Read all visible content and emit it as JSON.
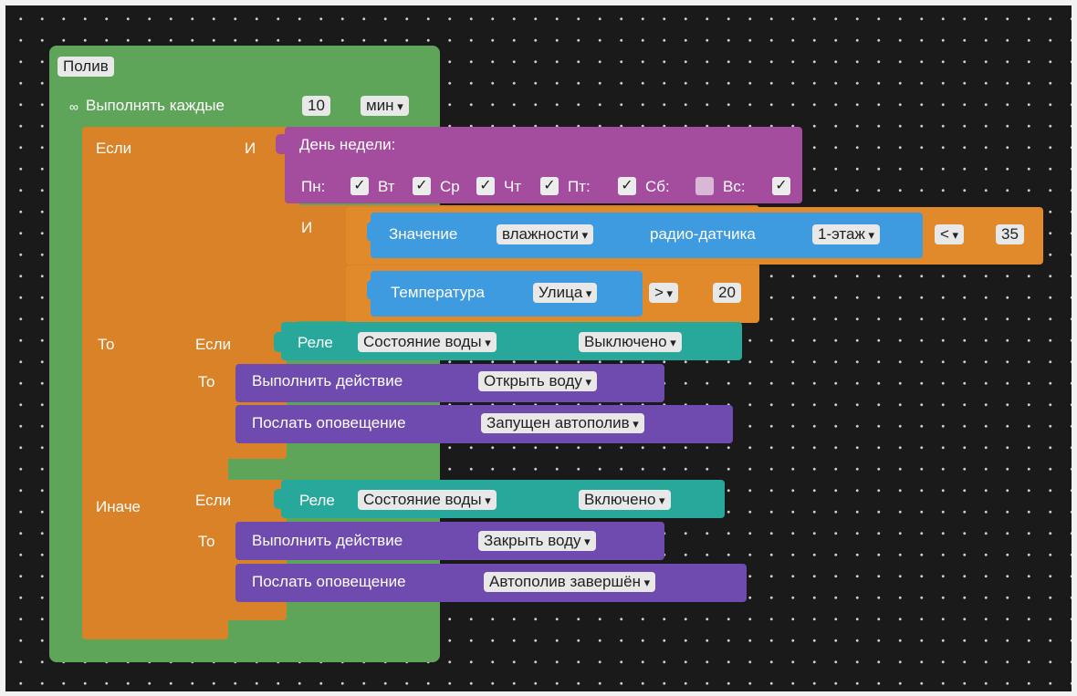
{
  "program": {
    "title": "Полив",
    "repeat": {
      "icon": "infinity-icon",
      "label": "Выполнять каждые",
      "interval": "10",
      "unit": "мин"
    }
  },
  "if_block": {
    "if_label": "Если",
    "then_label": "То",
    "else_label": "Иначе",
    "and_label": "И"
  },
  "weekday": {
    "title": "День недели:",
    "days": [
      {
        "label": "Пн:",
        "checked": true
      },
      {
        "label": "Вт",
        "checked": true
      },
      {
        "label": "Ср",
        "checked": true
      },
      {
        "label": "Чт",
        "checked": true
      },
      {
        "label": "Пт:",
        "checked": true
      },
      {
        "label": "Сб:",
        "checked": false
      },
      {
        "label": "Вс:",
        "checked": true
      }
    ]
  },
  "humidity": {
    "label": "Значение",
    "param": "влажности",
    "sensor_label": "радио-датчика",
    "sensor": "1-этаж",
    "op": "<",
    "value": "35"
  },
  "temperature": {
    "label": "Температура",
    "place": "Улица",
    "op": ">",
    "value": "20"
  },
  "then_branch": {
    "if_label": "Если",
    "then_label": "То",
    "relay_label": "Реле",
    "relay_param": "Состояние воды",
    "relay_state": "Выключено",
    "action_label": "Выполнить действие",
    "action": "Открыть воду",
    "notify_label": "Послать оповещение",
    "notify": "Запущен автополив"
  },
  "else_branch": {
    "if_label": "Если",
    "then_label": "То",
    "relay_label": "Реле",
    "relay_param": "Состояние воды",
    "relay_state": "Включено",
    "action_label": "Выполнить действие",
    "action": "Закрыть воду",
    "notify_label": "Послать оповещение",
    "notify": "Автополив завершён"
  },
  "colors": {
    "program": "#5ea55a",
    "control": "#d98227",
    "weekday": "#a44c9e",
    "sensor": "#3e9be0",
    "relay": "#27a89a",
    "action": "#6f4bb0",
    "background": "#1a1a1a"
  }
}
